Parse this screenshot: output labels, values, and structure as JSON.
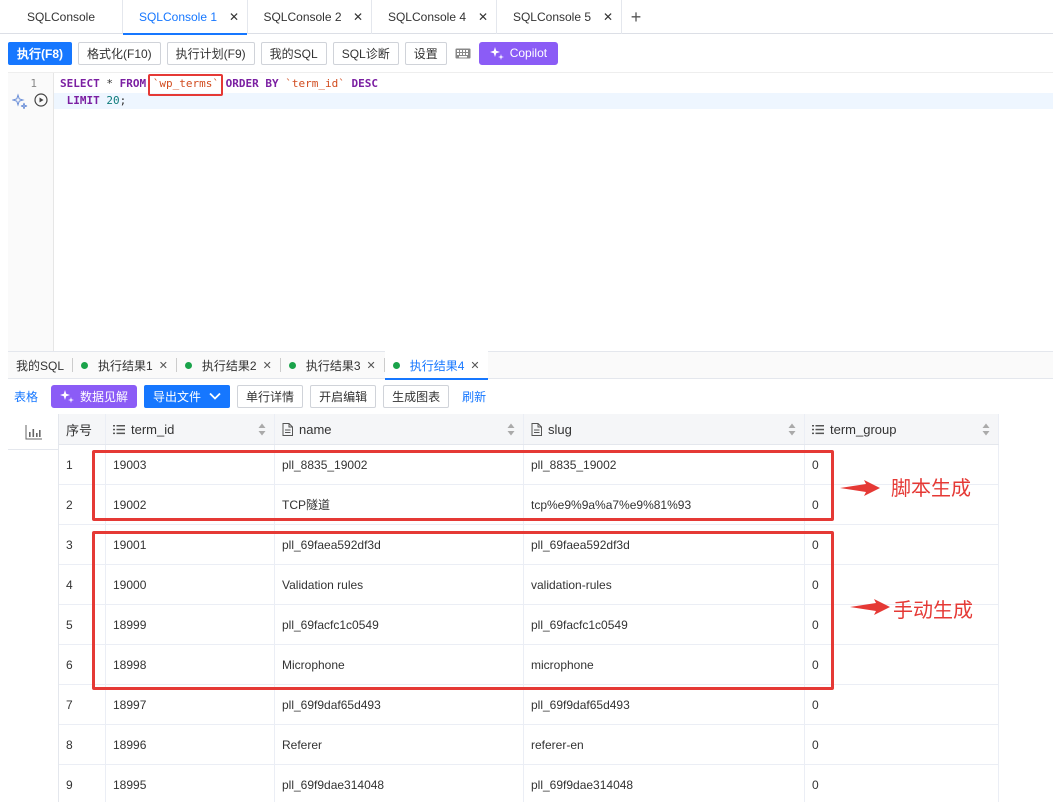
{
  "tabs": [
    {
      "label": "SQLConsole",
      "closable": false,
      "active": false
    },
    {
      "label": "SQLConsole 1",
      "closable": true,
      "active": true
    },
    {
      "label": "SQLConsole 2",
      "closable": true,
      "active": false
    },
    {
      "label": "SQLConsole 4",
      "closable": true,
      "active": false
    },
    {
      "label": "SQLConsole 5",
      "closable": true,
      "active": false
    }
  ],
  "toolbar": {
    "execute": "执行(F8)",
    "format": "格式化(F10)",
    "plan": "执行计划(F9)",
    "my_sql": "我的SQL",
    "diagnose": "SQL诊断",
    "settings": "设置",
    "copilot": "Copilot"
  },
  "editor": {
    "line_numbers": [
      "1"
    ],
    "line1": {
      "kw1": "SELECT",
      "star": " * ",
      "kw2": "FROM",
      "table": "`wp_terms`",
      "kw3": " ORDER BY ",
      "col": "`term_id`",
      "kw4": " DESC"
    },
    "line2": {
      "kw": "LIMIT",
      "num": "20",
      "end": ";"
    }
  },
  "result_tabs": [
    {
      "label": "我的SQL",
      "dot": false,
      "closable": false,
      "active": false
    },
    {
      "label": "执行结果1",
      "dot": true,
      "closable": true,
      "active": false
    },
    {
      "label": "执行结果2",
      "dot": true,
      "closable": true,
      "active": false
    },
    {
      "label": "执行结果3",
      "dot": true,
      "closable": true,
      "active": false
    },
    {
      "label": "执行结果4",
      "dot": true,
      "closable": true,
      "active": true
    }
  ],
  "result_toolbar": {
    "table": "表格",
    "insight": "数据见解",
    "export": "导出文件",
    "row_detail": "单行详情",
    "edit": "开启编辑",
    "gen_chart": "生成图表",
    "refresh": "刷新"
  },
  "grid": {
    "columns": [
      "序号",
      "term_id",
      "name",
      "slug",
      "term_group"
    ],
    "rows": [
      [
        "1",
        "19003",
        "pll_8835_19002",
        "pll_8835_19002",
        "0"
      ],
      [
        "2",
        "19002",
        "TCP隧道",
        "tcp%e9%9a%a7%e9%81%93",
        "0"
      ],
      [
        "3",
        "19001",
        "pll_69faea592df3d",
        "pll_69faea592df3d",
        "0"
      ],
      [
        "4",
        "19000",
        "Validation rules",
        "validation-rules",
        "0"
      ],
      [
        "5",
        "18999",
        "pll_69facfc1c0549",
        "pll_69facfc1c0549",
        "0"
      ],
      [
        "6",
        "18998",
        "Microphone",
        "microphone",
        "0"
      ],
      [
        "7",
        "18997",
        "pll_69f9daf65d493",
        "pll_69f9daf65d493",
        "0"
      ],
      [
        "8",
        "18996",
        "Referer",
        "referer-en",
        "0"
      ],
      [
        "9",
        "18995",
        "pll_69f9dae314048",
        "pll_69f9dae314048",
        "0"
      ]
    ]
  },
  "annotations": {
    "script_generated": "脚本生成",
    "manual_generated": "手动生成",
    "color": "#e53935"
  }
}
